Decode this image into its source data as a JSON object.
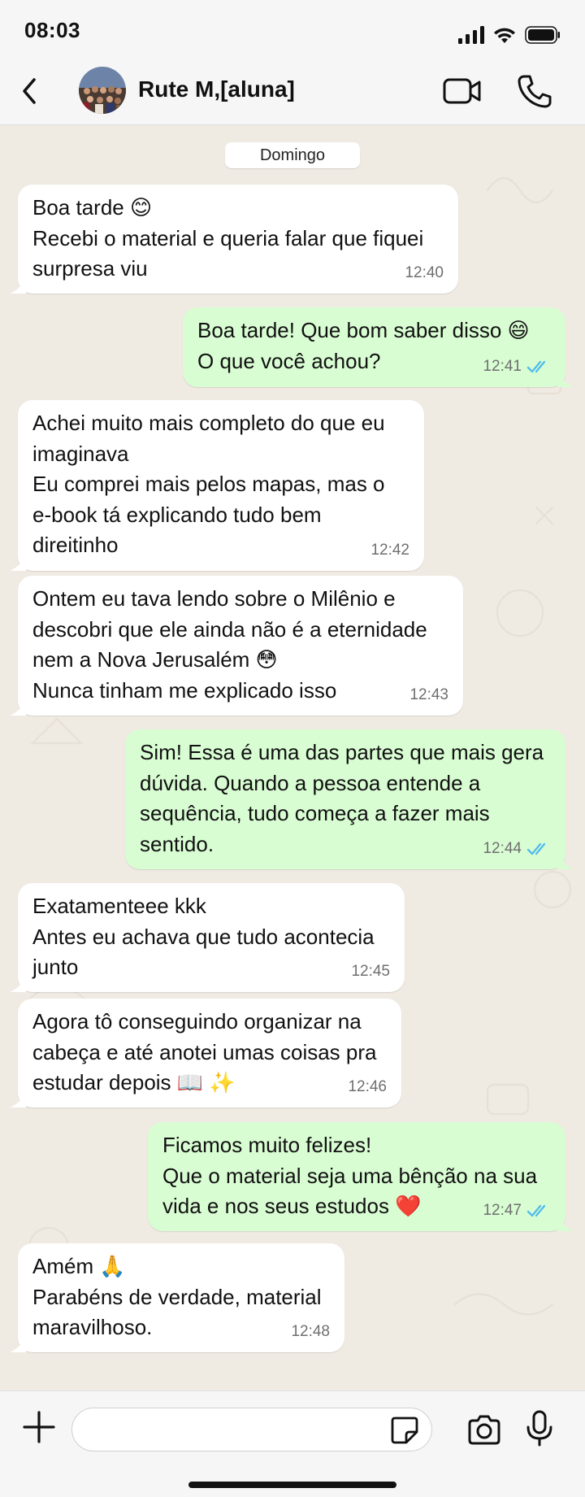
{
  "status_bar": {
    "time": "08:03"
  },
  "header": {
    "contact_name": "Rute M,[aluna]"
  },
  "chat": {
    "date_label": "Domingo",
    "messages": [
      {
        "dir": "in",
        "lines": [
          "Boa tarde 😊",
          "Recebi o material e queria falar que fiquei",
          "surpresa viu"
        ],
        "time": "12:40"
      },
      {
        "dir": "out",
        "lines": [
          "Boa tarde! Que bom saber disso 😄",
          "O que você achou?"
        ],
        "time": "12:41"
      },
      {
        "dir": "in",
        "lines": [
          "Achei muito mais completo do que eu",
          "imaginava",
          "Eu comprei mais pelos mapas, mas o",
          "e-book tá explicando tudo bem",
          "direitinho"
        ],
        "time": "12:42"
      },
      {
        "dir": "in",
        "lines": [
          "Ontem eu tava lendo sobre o Milênio e",
          "descobri que ele ainda não é a eternidade",
          "nem a Nova Jerusalém 😳",
          "Nunca tinham me explicado isso"
        ],
        "time": "12:43"
      },
      {
        "dir": "out",
        "lines": [
          "Sim! Essa é uma das partes que mais gera",
          "dúvida. Quando a pessoa entende a",
          "sequência, tudo começa a fazer mais",
          "sentido."
        ],
        "time": "12:44"
      },
      {
        "dir": "in",
        "lines": [
          "Exatamenteee kkk",
          "Antes eu achava que tudo acontecia",
          "junto"
        ],
        "time": "12:45"
      },
      {
        "dir": "in",
        "lines": [
          "Agora tô conseguindo organizar na",
          "cabeça e até anotei umas coisas pra",
          "estudar depois 📖 ✨"
        ],
        "time": "12:46"
      },
      {
        "dir": "out",
        "lines": [
          "Ficamos muito felizes!",
          "Que o material seja uma bênção na sua",
          "vida e nos seus estudos ❤️"
        ],
        "time": "12:47"
      },
      {
        "dir": "in",
        "lines": [
          "Amém 🙏",
          "Parabéns de verdade, material",
          "maravilhoso."
        ],
        "time": "12:48"
      }
    ]
  },
  "composer": {
    "placeholder": ""
  },
  "colors": {
    "incoming": "#ffffff",
    "outgoing": "#d9fdd3",
    "read_check": "#53bdeb",
    "wallpaper": "#efeae2"
  },
  "icons": [
    "back-arrow-icon",
    "video-camera-icon",
    "phone-icon",
    "plus-icon",
    "sticker-icon",
    "camera-icon",
    "microphone-icon",
    "double-check-icon"
  ]
}
